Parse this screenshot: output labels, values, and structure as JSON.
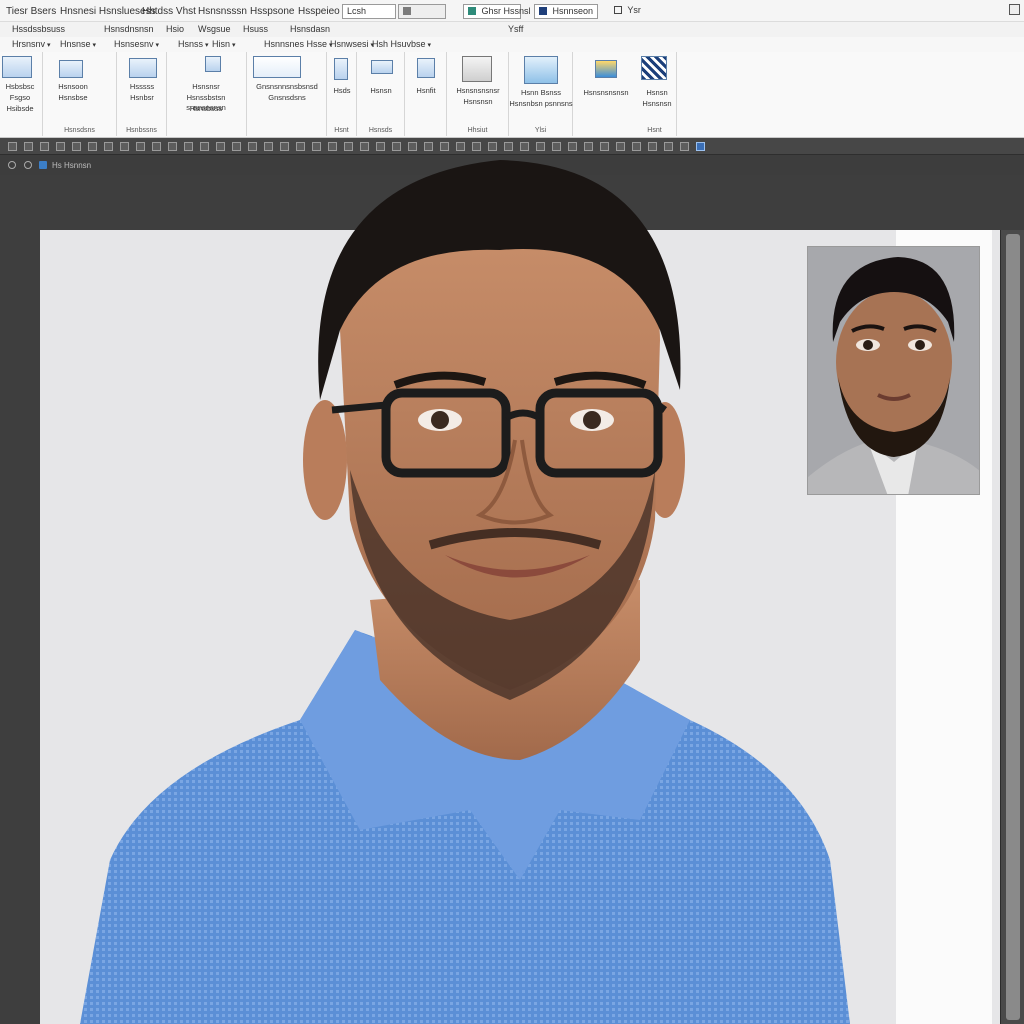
{
  "menubar": {
    "items": [
      "Tiesr Bsers",
      "Hnsnesi Hsnsluesess",
      "Hhtdss Vhst",
      "Hsnsnsssn",
      "Hsspsone",
      "Hsspeieo"
    ],
    "search_value": "Lcsh",
    "quick_button_1": "Ghsr Hssnsl",
    "quick_button_2": "Hsnnseon",
    "quick_button_3": "Ysr"
  },
  "tabs": [
    "Hssdssbsuss",
    "Hsnsdnsnsn",
    "Hsio",
    "Wsgsue",
    "Hsuss",
    "Hsnsdasn",
    "Ysff"
  ],
  "dropdowns": [
    "Hrsnsnv",
    "Hnsnse",
    "Hsnsesnv",
    "Hsnss",
    "Hisn",
    "Hsnnsnes Hsse",
    "Hsnwsesi",
    "Hsh Hsuvbse"
  ],
  "ribbon": {
    "groups": [
      {
        "buttons": [
          "Hsbsbsc",
          "Fsgso",
          "Hsibsde"
        ],
        "label": ""
      },
      {
        "buttons": [
          "Hsnsoon",
          "Hsnsbse"
        ],
        "label": "Hsnsdsns"
      },
      {
        "buttons": [
          "Hsssss",
          "Hsnbsr"
        ],
        "label": "Hsnbssns"
      },
      {
        "buttons": [
          "Hsnsnsr",
          "Hsnssbstsn snsnsnsnsn",
          "Hsnsbsss"
        ],
        "label": ""
      },
      {
        "buttons": [
          "Gnsnsnnsnsbsnsd",
          "Gnsnsdsns"
        ],
        "label": ""
      },
      {
        "buttons": [
          "Hsds"
        ],
        "label": "Hsnt"
      },
      {
        "buttons": [
          "Hsnsn"
        ],
        "label": "Hsnsds"
      },
      {
        "buttons": [
          "Hsnfit"
        ],
        "label": ""
      },
      {
        "buttons": [
          "Hsnsnsnsnsr",
          "Hsnsnsn"
        ],
        "label": "Hhsiut"
      },
      {
        "buttons": [
          "Hsnn Bsnss",
          "Hsnsnbsn psnnsns"
        ],
        "label": "Ylsi"
      },
      {
        "buttons": [
          "Hsnsnsnsnsn",
          "Hsnsn",
          "Hsnsnsn"
        ],
        "label": "Hsnt"
      }
    ]
  },
  "document": {
    "tab_name": "Hs Hsnnsn"
  },
  "colors": {
    "menubar_bg": "#f5f5f5",
    "ribbon_bg": "#f9f9f9",
    "workspace_bg": "#3e3e3e",
    "page_bg": "#e6e6e8",
    "shirt_blue": "#5b8fd6"
  }
}
